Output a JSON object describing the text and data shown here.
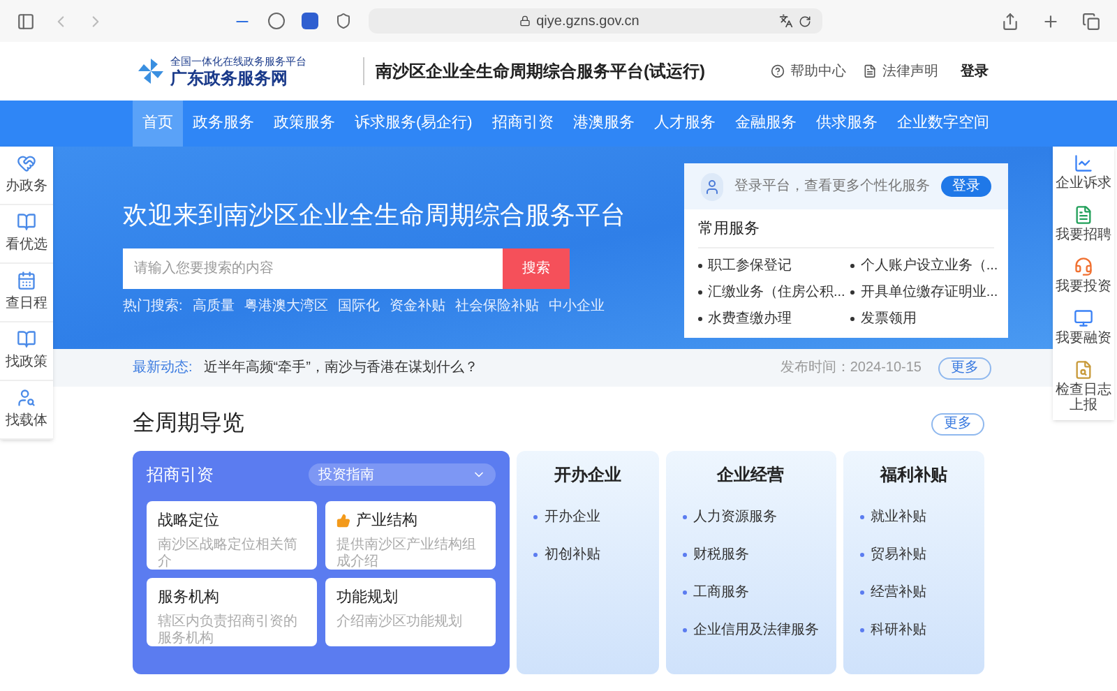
{
  "browser": {
    "url": "qiye.gzns.gov.cn"
  },
  "header": {
    "logo_caption": "全国一体化在线政务服务平台",
    "logo_name": "广东政务服务网",
    "title": "南沙区企业全生命周期综合服务平台(试运行)",
    "links": [
      {
        "label": "帮助中心"
      },
      {
        "label": "法律声明"
      }
    ],
    "login": "登录"
  },
  "nav": [
    {
      "label": "首页",
      "selected": true
    },
    {
      "label": "政务服务",
      "selected": false
    },
    {
      "label": "政策服务",
      "selected": false
    },
    {
      "label": "诉求服务(易企行)",
      "selected": false
    },
    {
      "label": "招商引资",
      "selected": false
    },
    {
      "label": "港澳服务",
      "selected": false
    },
    {
      "label": "人才服务",
      "selected": false
    },
    {
      "label": "金融服务",
      "selected": false
    },
    {
      "label": "供求服务",
      "selected": false
    },
    {
      "label": "企业数字空间",
      "selected": false
    }
  ],
  "left_sidebar": [
    {
      "label": "办政务"
    },
    {
      "label": "看优选"
    },
    {
      "label": "查日程"
    },
    {
      "label": "找政策"
    },
    {
      "label": "找载体"
    }
  ],
  "right_sidebar": [
    {
      "label": "企业诉求"
    },
    {
      "label": "我要招聘"
    },
    {
      "label": "我要投资"
    },
    {
      "label": "我要融资"
    },
    {
      "label": "检查日志上报"
    }
  ],
  "hero": {
    "title": "欢迎来到南沙区企业全生命周期综合服务平台",
    "search": {
      "placeholder": "请输入您要搜索的内容",
      "button": "搜索"
    },
    "hot_label": "热门搜索:",
    "hot": [
      "高质量",
      "粤港澳大湾区",
      "国际化",
      "资金补贴",
      "社会保险补贴",
      "中小企业"
    ]
  },
  "login_panel": {
    "prompt": "登录平台，查看更多个性化服务",
    "button": "登录",
    "services_title": "常用服务",
    "services": [
      "职工参保登记",
      "个人账户设立业务（...",
      "汇缴业务（住房公积...",
      "开具单位缴存证明业...",
      "水费查缴办理",
      "发票领用"
    ]
  },
  "news": {
    "label": "最新动态:",
    "text": "近半年高频“牵手”，南沙与香港在谋划什么？",
    "date": "发布时间：2024-10-15",
    "more": "更多"
  },
  "overview": {
    "title": "全周期导览",
    "more": "更多",
    "featured": {
      "title": "招商引资",
      "dropdown": "投资指南",
      "items": [
        {
          "title": "战略定位",
          "desc": "南沙区战略定位相关简介",
          "recommended": false
        },
        {
          "title": "产业结构",
          "desc": "提供南沙区产业结构组成介绍",
          "recommended": true
        },
        {
          "title": "服务机构",
          "desc": "辖区内负责招商引资的服务机构",
          "recommended": false
        },
        {
          "title": "功能规划",
          "desc": "介绍南沙区功能规划",
          "recommended": false
        }
      ]
    },
    "cards": [
      {
        "title": "开办企业",
        "items": [
          "开办企业",
          "初创补贴"
        ]
      },
      {
        "title": "企业经营",
        "items": [
          "人力资源服务",
          "财税服务",
          "工商服务",
          "企业信用及法律服务"
        ]
      },
      {
        "title": "福利补贴",
        "items": [
          "就业补贴",
          "贸易补贴",
          "经营补贴",
          "科研补贴"
        ]
      }
    ]
  }
}
